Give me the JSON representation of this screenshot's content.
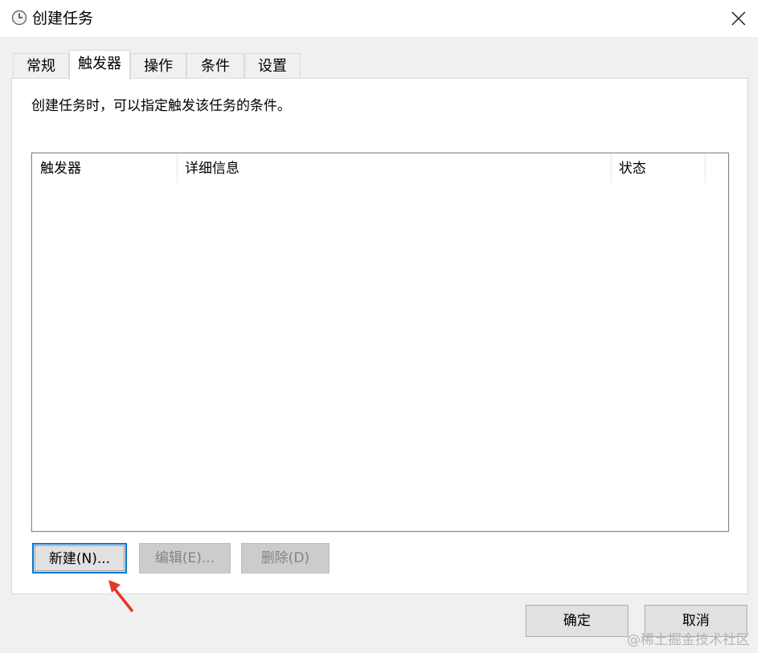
{
  "window": {
    "title": "创建任务",
    "icon": "clock-icon",
    "close_icon": "close-icon"
  },
  "tabs": [
    {
      "label": "常规",
      "active": false
    },
    {
      "label": "触发器",
      "active": true
    },
    {
      "label": "操作",
      "active": false
    },
    {
      "label": "条件",
      "active": false
    },
    {
      "label": "设置",
      "active": false
    }
  ],
  "triggers_tab": {
    "description": "创建任务时，可以指定触发该任务的条件。",
    "columns": [
      "触发器",
      "详细信息",
      "状态"
    ],
    "rows": []
  },
  "buttons": {
    "new": "新建(N)...",
    "edit": "编辑(E)...",
    "delete": "删除(D)",
    "ok": "确定",
    "cancel": "取消"
  },
  "watermark": "@稀土掘金技术社区",
  "colors": {
    "focus_border": "#0078d7",
    "annotation_arrow": "#e8352b",
    "disabled_text": "#838383"
  }
}
